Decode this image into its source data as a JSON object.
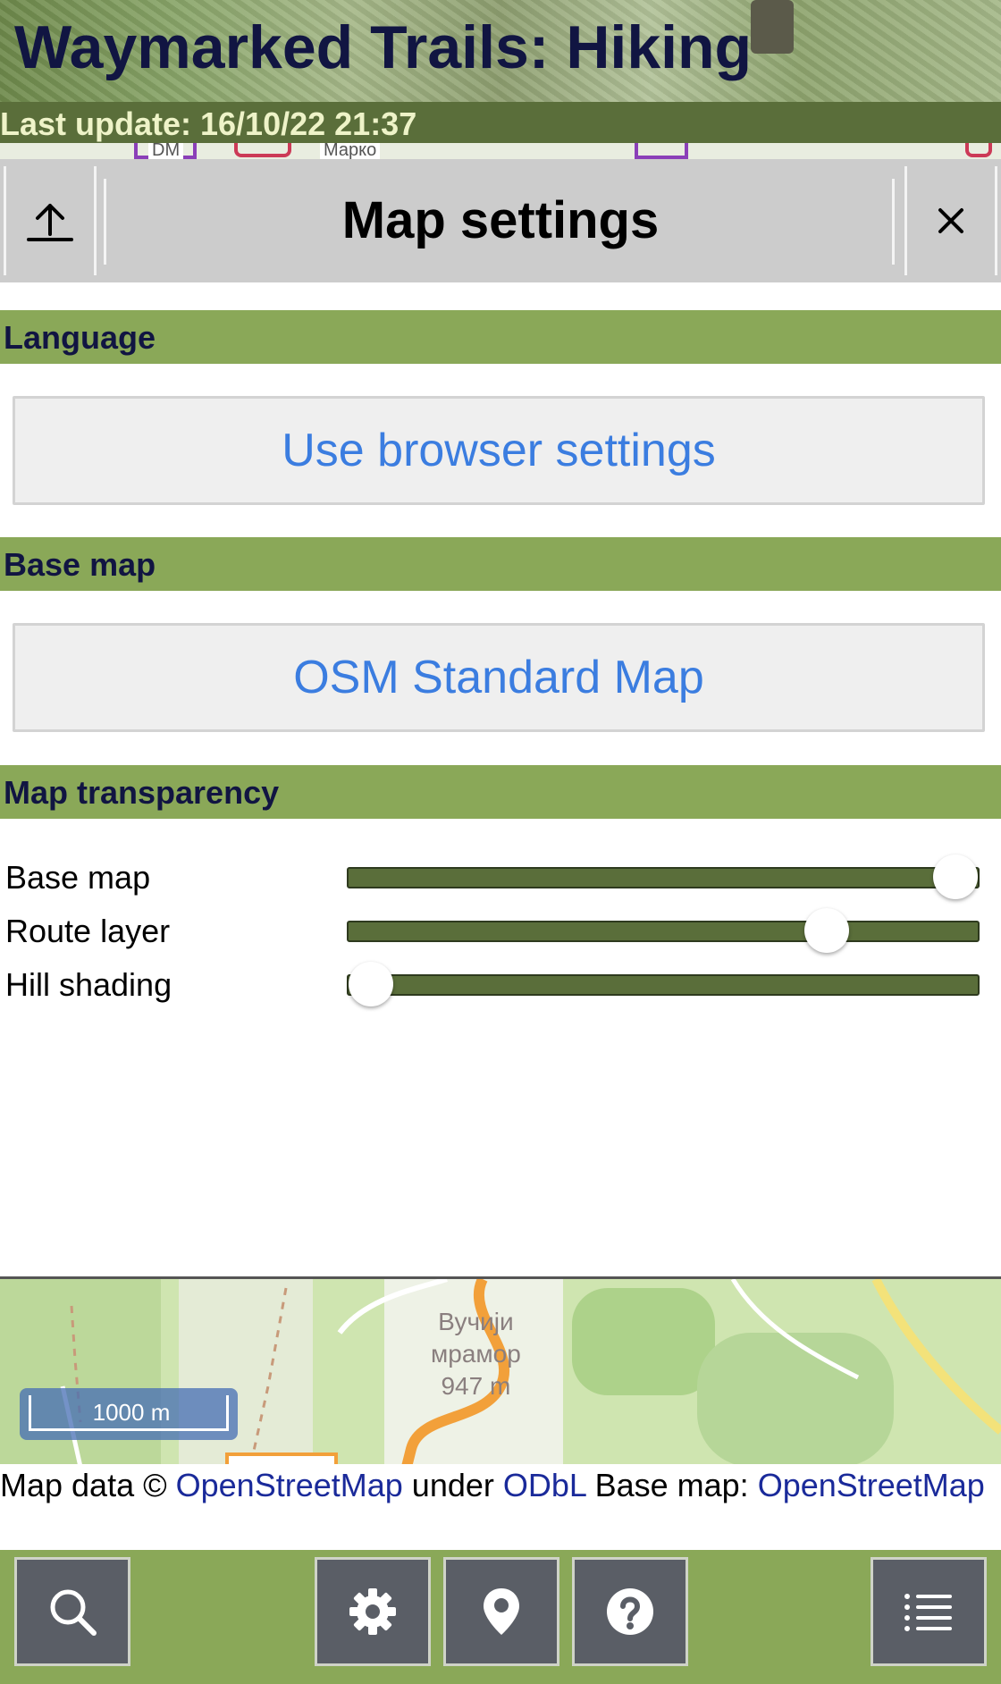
{
  "header": {
    "title": "Waymarked Trails: Hiking",
    "last_update": "Last update: 16/10/22 21:37",
    "map_labels": [
      "DM",
      "Марко"
    ]
  },
  "panel": {
    "title": "Map settings",
    "upload_icon": "upload-icon",
    "close_icon": "close-icon"
  },
  "sections": {
    "language": {
      "heading": "Language",
      "button_label": "Use browser settings"
    },
    "base_map": {
      "heading": "Base map",
      "button_label": "OSM Standard Map"
    },
    "transparency": {
      "heading": "Map transparency",
      "sliders": [
        {
          "label": "Base map",
          "value": 1.0
        },
        {
          "label": "Route layer",
          "value": 0.78
        },
        {
          "label": "Hill shading",
          "value": 0.0
        }
      ]
    }
  },
  "map": {
    "peak_label": "Вучији мрамор 947 m",
    "peak_lines": [
      "Вучији",
      "мрамор",
      "947 m"
    ],
    "scale": "1000 m"
  },
  "attribution": {
    "prefix": "Map data © ",
    "osm_link": "OpenStreetMap",
    "under": " under ",
    "odbl_link": "ODbL",
    "base_map_text": " Base map: ",
    "base_map_link": "OpenStreetMap"
  },
  "toolbar": {
    "buttons": [
      {
        "icon": "search-icon"
      },
      {
        "icon": "gear-icon"
      },
      {
        "icon": "location-pin-icon"
      },
      {
        "icon": "help-icon"
      },
      {
        "icon": "list-icon"
      }
    ]
  },
  "colors": {
    "section_green": "#8aa858",
    "dark_green": "#5a6e3a",
    "title_navy": "#111542",
    "link_blue": "#3b7de0",
    "tool_button": "#5a5e66"
  }
}
